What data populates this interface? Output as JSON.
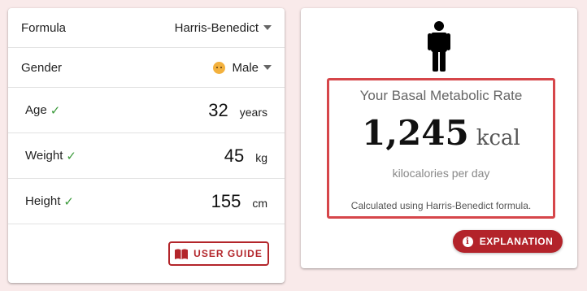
{
  "form": {
    "formula": {
      "label": "Formula",
      "value": "Harris-Benedict"
    },
    "gender": {
      "label": "Gender",
      "value": "Male",
      "icon": "male-face-emoji"
    },
    "age": {
      "label": "Age",
      "check": "✓",
      "value": "32",
      "unit": "years"
    },
    "weight": {
      "label": "Weight",
      "check": "✓",
      "value": "45",
      "unit": "kg"
    },
    "height": {
      "label": "Height",
      "check": "✓",
      "value": "155",
      "unit": "cm"
    },
    "user_guide_label": "USER GUIDE"
  },
  "result": {
    "icon": "person-icon",
    "title": "Your Basal Metabolic Rate",
    "value": "1,245",
    "unit": "kcal",
    "subtitle": "kilocalories per day",
    "note": "Calculated using Harris-Benedict formula.",
    "explanation_label": "EXPLANATION",
    "explanation_icon": "info-icon"
  },
  "colors": {
    "background": "#f9eaea",
    "accent": "#b3232a",
    "result_border": "#d6464a",
    "check": "#3c9b3c"
  }
}
